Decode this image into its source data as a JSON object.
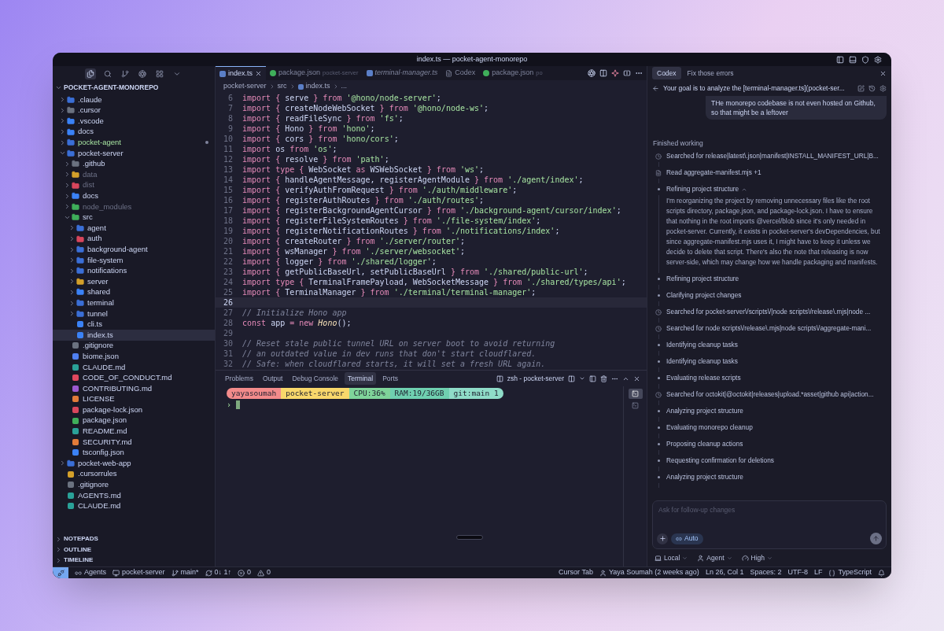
{
  "window": {
    "title": "index.ts — pocket-agent-monorepo"
  },
  "activity_bar": [
    {
      "kind": "explorer",
      "selected": true
    },
    {
      "kind": "search",
      "selected": false
    },
    {
      "kind": "source-control",
      "selected": false
    },
    {
      "kind": "aperture",
      "selected": false
    },
    {
      "kind": "extensions",
      "selected": false
    },
    {
      "kind": "overflow",
      "selected": false
    }
  ],
  "explorer": {
    "root": "POCKET-AGENT-MONOREPO",
    "root_expanded": true,
    "items": [
      {
        "kind": "folder",
        "label": ".claude",
        "color": "#3b6fd6",
        "expanded": false,
        "selected": false
      },
      {
        "kind": "folder",
        "label": ".cursor",
        "color": "#6b7280",
        "expanded": false,
        "selected": false
      },
      {
        "kind": "folder",
        "label": ".vscode",
        "color": "#3b82f6",
        "expanded": false,
        "selected": false
      },
      {
        "kind": "folder",
        "label": "docs",
        "color": "#3b82f6",
        "expanded": false,
        "selected": false
      },
      {
        "kind": "folder",
        "label": "pocket-agent",
        "color": "#3b6fd6",
        "expanded": false,
        "selected": false,
        "modified": true
      },
      {
        "kind": "folder",
        "label": "pocket-server",
        "color": "#3b6fd6",
        "expanded": true,
        "selected": false,
        "children": [
          {
            "kind": "folder",
            "label": ".github",
            "color": "#6b7280",
            "expanded": false,
            "selected": false
          },
          {
            "kind": "folder",
            "label": "data",
            "color": "#d4a02a",
            "expanded": false,
            "selected": false,
            "ignored": true
          },
          {
            "kind": "folder",
            "label": "dist",
            "color": "#d8465c",
            "expanded": false,
            "selected": false,
            "ignored": true
          },
          {
            "kind": "folder",
            "label": "docs",
            "color": "#3b82f6",
            "expanded": false,
            "selected": false
          },
          {
            "kind": "folder",
            "label": "node_modules",
            "color": "#3fae5a",
            "expanded": false,
            "selected": false,
            "ignored": true
          },
          {
            "kind": "folder",
            "label": "src",
            "color": "#3fae5a",
            "expanded": true,
            "selected": false,
            "children": [
              {
                "kind": "folder",
                "label": "agent",
                "color": "#3b6fd6",
                "expanded": false,
                "selected": false
              },
              {
                "kind": "folder",
                "label": "auth",
                "color": "#d8465c",
                "expanded": false,
                "selected": false
              },
              {
                "kind": "folder",
                "label": "background-agent",
                "color": "#3b6fd6",
                "expanded": false,
                "selected": false
              },
              {
                "kind": "folder",
                "label": "file-system",
                "color": "#3b6fd6",
                "expanded": false,
                "selected": false
              },
              {
                "kind": "folder",
                "label": "notifications",
                "color": "#3b6fd6",
                "expanded": false,
                "selected": false
              },
              {
                "kind": "folder",
                "label": "server",
                "color": "#d4a02a",
                "expanded": false,
                "selected": false
              },
              {
                "kind": "folder",
                "label": "shared",
                "color": "#3b82f6",
                "expanded": false,
                "selected": false
              },
              {
                "kind": "folder",
                "label": "terminal",
                "color": "#3b6fd6",
                "expanded": false,
                "selected": false
              },
              {
                "kind": "folder",
                "label": "tunnel",
                "color": "#3b6fd6",
                "expanded": false,
                "selected": false
              },
              {
                "kind": "file",
                "label": "cli.ts",
                "color": "#3b82f6",
                "selected": false
              },
              {
                "kind": "file",
                "label": "index.ts",
                "color": "#3b82f6",
                "selected": true
              }
            ]
          },
          {
            "kind": "file",
            "label": ".gitignore",
            "color": "#6b7280",
            "selected": false
          },
          {
            "kind": "file",
            "label": "biome.json",
            "color": "#4f7ff0",
            "selected": false
          },
          {
            "kind": "file",
            "label": "CLAUDE.md",
            "color": "#2aa198",
            "selected": false
          },
          {
            "kind": "file",
            "label": "CODE_OF_CONDUCT.md",
            "color": "#e0485e",
            "selected": false
          },
          {
            "kind": "file",
            "label": "CONTRIBUTING.md",
            "color": "#9b59d0",
            "selected": false
          },
          {
            "kind": "file",
            "label": "LICENSE",
            "color": "#e07b39",
            "selected": false
          },
          {
            "kind": "file",
            "label": "package-lock.json",
            "color": "#d8465c",
            "selected": false
          },
          {
            "kind": "file",
            "label": "package.json",
            "color": "#3fae5a",
            "selected": false
          },
          {
            "kind": "file",
            "label": "README.md",
            "color": "#2aa198",
            "selected": false
          },
          {
            "kind": "file",
            "label": "SECURITY.md",
            "color": "#e07b39",
            "selected": false
          },
          {
            "kind": "file",
            "label": "tsconfig.json",
            "color": "#3b82f6",
            "selected": false
          }
        ]
      },
      {
        "kind": "folder",
        "label": "pocket-web-app",
        "color": "#3b6fd6",
        "expanded": false,
        "selected": false
      },
      {
        "kind": "file",
        "label": ".cursorrules",
        "color": "#d4a02a",
        "selected": false
      },
      {
        "kind": "file",
        "label": ".gitignore",
        "color": "#6b7280",
        "selected": false
      },
      {
        "kind": "file",
        "label": "AGENTS.md",
        "color": "#2aa198",
        "selected": false
      },
      {
        "kind": "file",
        "label": "CLAUDE.md",
        "color": "#2aa198",
        "selected": false
      }
    ]
  },
  "sections": [
    {
      "label": "NOTEPADS",
      "expanded": false
    },
    {
      "label": "OUTLINE",
      "expanded": false
    },
    {
      "label": "TIMELINE",
      "expanded": false
    }
  ],
  "tabs": [
    {
      "label": "index.ts",
      "kind": "typescript",
      "selected": true,
      "preview": false
    },
    {
      "label": "package.json",
      "description": "pocket-server",
      "kind": "package",
      "selected": false,
      "preview": false
    },
    {
      "label": "terminal-manager.ts",
      "kind": "typescript",
      "selected": false,
      "preview": true
    },
    {
      "label": "Codex",
      "kind": "document",
      "selected": false,
      "preview": false
    },
    {
      "label": "package.json",
      "description": "po",
      "kind": "package",
      "selected": false,
      "preview": false
    }
  ],
  "breadcrumb": [
    "pocket-server",
    "src",
    "index.ts",
    "..."
  ],
  "code": [
    {
      "number": "6",
      "current": false,
      "segments": [
        {
          "kind": "keyword",
          "text": "import { "
        },
        {
          "kind": "plain",
          "text": "serve"
        },
        {
          "kind": "keyword",
          "text": " } from "
        },
        {
          "kind": "string",
          "text": "'@hono/node-server'"
        },
        {
          "kind": "plain",
          "text": ";"
        }
      ]
    },
    {
      "number": "7",
      "current": false,
      "segments": [
        {
          "kind": "keyword",
          "text": "import { "
        },
        {
          "kind": "plain",
          "text": "createNodeWebSocket"
        },
        {
          "kind": "keyword",
          "text": " } from "
        },
        {
          "kind": "string",
          "text": "'@hono/node-ws'"
        },
        {
          "kind": "plain",
          "text": ";"
        }
      ]
    },
    {
      "number": "8",
      "current": false,
      "segments": [
        {
          "kind": "keyword",
          "text": "import { "
        },
        {
          "kind": "plain",
          "text": "readFileSync"
        },
        {
          "kind": "keyword",
          "text": " } from "
        },
        {
          "kind": "string",
          "text": "'fs'"
        },
        {
          "kind": "plain",
          "text": ";"
        }
      ]
    },
    {
      "number": "9",
      "current": false,
      "segments": [
        {
          "kind": "keyword",
          "text": "import { "
        },
        {
          "kind": "plain",
          "text": "Hono"
        },
        {
          "kind": "keyword",
          "text": " } from "
        },
        {
          "kind": "string",
          "text": "'hono'"
        },
        {
          "kind": "plain",
          "text": ";"
        }
      ]
    },
    {
      "number": "10",
      "current": false,
      "segments": [
        {
          "kind": "keyword",
          "text": "import { "
        },
        {
          "kind": "plain",
          "text": "cors"
        },
        {
          "kind": "keyword",
          "text": " } from "
        },
        {
          "kind": "string",
          "text": "'hono/cors'"
        },
        {
          "kind": "plain",
          "text": ";"
        }
      ]
    },
    {
      "number": "11",
      "current": false,
      "segments": [
        {
          "kind": "keyword",
          "text": "import "
        },
        {
          "kind": "plain",
          "text": "os "
        },
        {
          "kind": "keyword",
          "text": "from "
        },
        {
          "kind": "string",
          "text": "'os'"
        },
        {
          "kind": "plain",
          "text": ";"
        }
      ]
    },
    {
      "number": "12",
      "current": false,
      "segments": [
        {
          "kind": "keyword",
          "text": "import { "
        },
        {
          "kind": "plain",
          "text": "resolve"
        },
        {
          "kind": "keyword",
          "text": " } from "
        },
        {
          "kind": "string",
          "text": "'path'"
        },
        {
          "kind": "plain",
          "text": ";"
        }
      ]
    },
    {
      "number": "13",
      "current": false,
      "segments": [
        {
          "kind": "keyword",
          "text": "import type { "
        },
        {
          "kind": "plain",
          "text": "WebSocket "
        },
        {
          "kind": "keyword",
          "text": "as "
        },
        {
          "kind": "plain",
          "text": "WSWebSocket"
        },
        {
          "kind": "keyword",
          "text": " } from "
        },
        {
          "kind": "string",
          "text": "'ws'"
        },
        {
          "kind": "plain",
          "text": ";"
        }
      ]
    },
    {
      "number": "14",
      "current": false,
      "segments": [
        {
          "kind": "keyword",
          "text": "import { "
        },
        {
          "kind": "plain",
          "text": "handleAgentMessage, registerAgentModule"
        },
        {
          "kind": "keyword",
          "text": " } from "
        },
        {
          "kind": "string",
          "text": "'./agent/index'"
        },
        {
          "kind": "plain",
          "text": ";"
        }
      ]
    },
    {
      "number": "15",
      "current": false,
      "segments": [
        {
          "kind": "keyword",
          "text": "import { "
        },
        {
          "kind": "plain",
          "text": "verifyAuthFromRequest"
        },
        {
          "kind": "keyword",
          "text": " } from "
        },
        {
          "kind": "string",
          "text": "'./auth/middleware'"
        },
        {
          "kind": "plain",
          "text": ";"
        }
      ]
    },
    {
      "number": "16",
      "current": false,
      "segments": [
        {
          "kind": "keyword",
          "text": "import { "
        },
        {
          "kind": "plain",
          "text": "registerAuthRoutes"
        },
        {
          "kind": "keyword",
          "text": " } from "
        },
        {
          "kind": "string",
          "text": "'./auth/routes'"
        },
        {
          "kind": "plain",
          "text": ";"
        }
      ]
    },
    {
      "number": "17",
      "current": false,
      "segments": [
        {
          "kind": "keyword",
          "text": "import { "
        },
        {
          "kind": "plain",
          "text": "registerBackgroundAgentCursor"
        },
        {
          "kind": "keyword",
          "text": " } from "
        },
        {
          "kind": "string",
          "text": "'./background-agent/cursor/index'"
        },
        {
          "kind": "plain",
          "text": ";"
        }
      ]
    },
    {
      "number": "18",
      "current": false,
      "segments": [
        {
          "kind": "keyword",
          "text": "import { "
        },
        {
          "kind": "plain",
          "text": "registerFileSystemRoutes"
        },
        {
          "kind": "keyword",
          "text": " } from "
        },
        {
          "kind": "string",
          "text": "'./file-system/index'"
        },
        {
          "kind": "plain",
          "text": ";"
        }
      ]
    },
    {
      "number": "19",
      "current": false,
      "segments": [
        {
          "kind": "keyword",
          "text": "import { "
        },
        {
          "kind": "plain",
          "text": "registerNotificationRoutes"
        },
        {
          "kind": "keyword",
          "text": " } from "
        },
        {
          "kind": "string",
          "text": "'./notifications/index'"
        },
        {
          "kind": "plain",
          "text": ";"
        }
      ]
    },
    {
      "number": "20",
      "current": false,
      "segments": [
        {
          "kind": "keyword",
          "text": "import { "
        },
        {
          "kind": "plain",
          "text": "createRouter"
        },
        {
          "kind": "keyword",
          "text": " } from "
        },
        {
          "kind": "string",
          "text": "'./server/router'"
        },
        {
          "kind": "plain",
          "text": ";"
        }
      ]
    },
    {
      "number": "21",
      "current": false,
      "segments": [
        {
          "kind": "keyword",
          "text": "import { "
        },
        {
          "kind": "plain",
          "text": "wsManager"
        },
        {
          "kind": "keyword",
          "text": " } from "
        },
        {
          "kind": "string",
          "text": "'./server/websocket'"
        },
        {
          "kind": "plain",
          "text": ";"
        }
      ]
    },
    {
      "number": "22",
      "current": false,
      "segments": [
        {
          "kind": "keyword",
          "text": "import { "
        },
        {
          "kind": "plain",
          "text": "logger"
        },
        {
          "kind": "keyword",
          "text": " } from "
        },
        {
          "kind": "string",
          "text": "'./shared/logger'"
        },
        {
          "kind": "plain",
          "text": ";"
        }
      ]
    },
    {
      "number": "23",
      "current": false,
      "segments": [
        {
          "kind": "keyword",
          "text": "import { "
        },
        {
          "kind": "plain",
          "text": "getPublicBaseUrl, setPublicBaseUrl"
        },
        {
          "kind": "keyword",
          "text": " } from "
        },
        {
          "kind": "string",
          "text": "'./shared/public-url'"
        },
        {
          "kind": "plain",
          "text": ";"
        }
      ]
    },
    {
      "number": "24",
      "current": false,
      "segments": [
        {
          "kind": "keyword",
          "text": "import type { "
        },
        {
          "kind": "plain",
          "text": "TerminalFramePayload, WebSocketMessage"
        },
        {
          "kind": "keyword",
          "text": " } from "
        },
        {
          "kind": "string",
          "text": "'./shared/types/api'"
        },
        {
          "kind": "plain",
          "text": ";"
        }
      ]
    },
    {
      "number": "25",
      "current": false,
      "segments": [
        {
          "kind": "keyword",
          "text": "import { "
        },
        {
          "kind": "plain",
          "text": "TerminalManager"
        },
        {
          "kind": "keyword",
          "text": " } from "
        },
        {
          "kind": "string",
          "text": "'./terminal/terminal-manager'"
        },
        {
          "kind": "plain",
          "text": ";"
        }
      ]
    },
    {
      "number": "26",
      "current": true
    },
    {
      "number": "27",
      "current": false,
      "segments": [
        {
          "kind": "comment",
          "text": "// Initialize Hono app"
        }
      ]
    },
    {
      "number": "28",
      "current": false,
      "segments": [
        {
          "kind": "keyword",
          "text": "const "
        },
        {
          "kind": "plain",
          "text": "app "
        },
        {
          "kind": "keyword",
          "text": "= new "
        },
        {
          "kind": "type",
          "text": "Hono"
        },
        {
          "kind": "plain",
          "text": "();"
        }
      ]
    },
    {
      "number": "29",
      "current": false
    },
    {
      "number": "30",
      "current": false,
      "segments": [
        {
          "kind": "comment",
          "text": "// Reset stale public tunnel URL on server boot to avoid returning"
        }
      ]
    },
    {
      "number": "31",
      "current": false,
      "segments": [
        {
          "kind": "comment",
          "text": "// an outdated value in dev runs that don't start cloudflared."
        }
      ]
    },
    {
      "number": "32",
      "current": false,
      "segments": [
        {
          "kind": "comment",
          "text": "// Safe: when cloudflared starts, it will set a fresh URL again."
        }
      ]
    }
  ],
  "panel": {
    "tabs": [
      {
        "label": "Problems",
        "selected": false
      },
      {
        "label": "Output",
        "selected": false
      },
      {
        "label": "Debug Console",
        "selected": false
      },
      {
        "label": "Terminal",
        "selected": true
      },
      {
        "label": "Ports",
        "selected": false
      }
    ],
    "terminal_name": "zsh - pocket-server",
    "prompt": [
      {
        "text": "yayasoumah",
        "color": "#f38b8b"
      },
      {
        "text": "pocket-server",
        "color": "#f9d86b"
      },
      {
        "text": "CPU:36%",
        "color": "#7fd49a"
      },
      {
        "text": "RAM:19/36GB",
        "color": "#6fd0b0"
      },
      {
        "text": "git:main 1",
        "color": "#8fdcc8"
      }
    ],
    "prompt_symbol": "›",
    "terminals": [
      {
        "selected": true
      },
      {
        "selected": false
      }
    ]
  },
  "status_bar": {
    "left": [
      {
        "kind": "agents",
        "text": "Agents"
      },
      {
        "kind": "workspace",
        "text": "pocket-server"
      },
      {
        "kind": "branch",
        "text": "main*"
      },
      {
        "kind": "sync",
        "text": "0↓ 1↑"
      },
      {
        "kind": "errors",
        "text": "0"
      },
      {
        "kind": "warnings",
        "text": "0"
      }
    ],
    "right": [
      {
        "kind": "plain",
        "text": "Cursor Tab"
      },
      {
        "kind": "blame",
        "text": "Yaya Soumah (2 weeks ago)"
      },
      {
        "kind": "plain",
        "text": "Ln 26, Col 1"
      },
      {
        "kind": "plain",
        "text": "Spaces: 2"
      },
      {
        "kind": "plain",
        "text": "UTF-8"
      },
      {
        "kind": "plain",
        "text": "LF"
      },
      {
        "kind": "language",
        "text": "TypeScript"
      }
    ]
  },
  "codex": {
    "tabs": [
      {
        "label": "Codex",
        "selected": true
      },
      {
        "label": "Fix those errors",
        "selected": false
      }
    ],
    "thread_title": "Your goal is to analyze the [terminal-manager.ts](pocket-ser...",
    "user_message": "THe monorepo codebase is not even hosted on Github, so that might be a leftover",
    "status": "Finished working",
    "steps": [
      {
        "kind": "search",
        "text": "Searched for release|latest\\.json|manifest|INSTALL_MANIFEST_URL|B..."
      },
      {
        "kind": "read",
        "text": "Read aggregate-manifest.mjs +1"
      },
      {
        "kind": "thought",
        "text": "Refining project structure",
        "expanded": true,
        "body": "I'm reorganizing the project by removing unnecessary files like the root scripts directory, package.json, and package-lock.json. I have to ensure that nothing in the root imports @vercel/blob since it's only needed in pocket-server. Currently, it exists in pocket-server's devDependencies, but since aggregate-manifest.mjs uses it, I might have to keep it unless we decide to delete that script. There's also the note that releasing is now server-side, which may change how we handle packaging and manifests."
      },
      {
        "kind": "thought",
        "text": "Refining project structure"
      },
      {
        "kind": "thought",
        "text": "Clarifying project changes"
      },
      {
        "kind": "search",
        "text": "Searched for pocket-server\\/scripts\\/|node scripts\\/release\\.mjs|node ..."
      },
      {
        "kind": "search",
        "text": "Searched for node scripts\\/release\\.mjs|node scripts\\/aggregate-mani..."
      },
      {
        "kind": "thought",
        "text": "Identifying cleanup tasks"
      },
      {
        "kind": "thought",
        "text": "Identifying cleanup tasks"
      },
      {
        "kind": "thought",
        "text": "Evaluating release scripts"
      },
      {
        "kind": "search",
        "text": "Searched for octokit|@octokit|releases|upload.*asset|github api|action..."
      },
      {
        "kind": "thought",
        "text": "Analyzing project structure"
      },
      {
        "kind": "thought",
        "text": "Evaluating monorepo cleanup"
      },
      {
        "kind": "thought",
        "text": "Proposing cleanup actions"
      },
      {
        "kind": "thought",
        "text": "Requesting confirmation for deletions"
      },
      {
        "kind": "thought",
        "text": "Analyzing project structure"
      }
    ],
    "input": {
      "placeholder": "Ask for follow-up changes",
      "mode": "Auto"
    },
    "options": [
      {
        "kind": "location",
        "label": "Local"
      },
      {
        "kind": "agent",
        "label": "Agent"
      },
      {
        "kind": "effort",
        "label": "High"
      }
    ]
  }
}
